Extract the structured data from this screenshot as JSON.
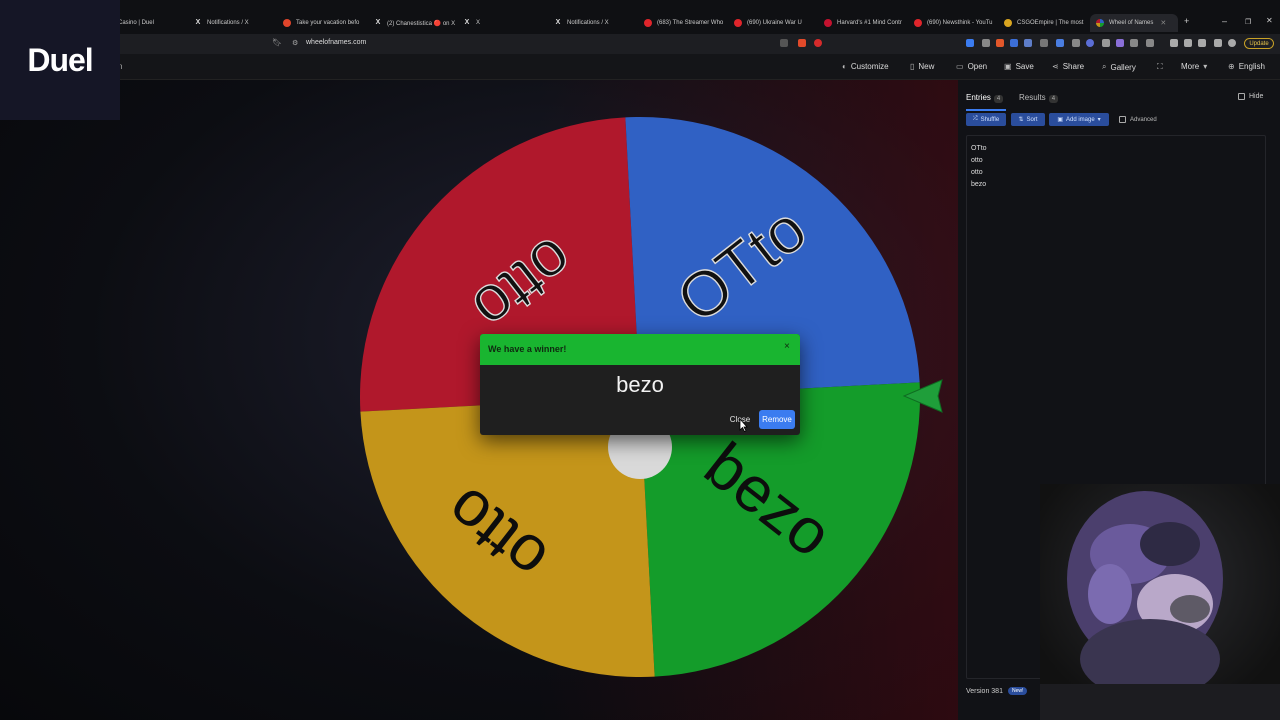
{
  "browser": {
    "tabs": [
      {
        "label": "Casino | Duel",
        "icon": "duel-favicon"
      },
      {
        "label": "Notifications / X",
        "icon": "x-icon"
      },
      {
        "label": "Take your vacation befo",
        "icon": "site-favicon"
      },
      {
        "label": "(2) Chanestisticа 🔴 on X",
        "icon": "x-icon"
      },
      {
        "label": "X",
        "icon": "x-icon"
      },
      {
        "label": "Notifications / X",
        "icon": "x-icon"
      },
      {
        "label": "(683) The Streamer Who",
        "icon": "youtube-icon"
      },
      {
        "label": "(690) Ukraine War U",
        "icon": "youtube-icon"
      },
      {
        "label": "Harvard's #1 Mind Contr",
        "icon": "site-favicon"
      },
      {
        "label": "(690) Newsthink - YouTu",
        "icon": "youtube-icon"
      },
      {
        "label": "CSGOEmpire | The most",
        "icon": "site-favicon"
      },
      {
        "label": "Wheel of Names",
        "icon": "wheel-favicon"
      }
    ],
    "new_tab": "+",
    "window_controls": [
      "–",
      "❐",
      "✕"
    ],
    "url": "wheelofnames.com",
    "update_label": "Update"
  },
  "brand_overlay": {
    "text": "Duel"
  },
  "app_menu": {
    "customize": "Customize",
    "new": "New",
    "open": "Open",
    "save": "Save",
    "share": "Share",
    "gallery": "Gallery",
    "more": "More",
    "language": "English",
    "left_fragment": "n"
  },
  "wheel": {
    "segments": [
      {
        "label": "OTto",
        "color": "#3061c4"
      },
      {
        "label": "bezo",
        "color": "#149c2a"
      },
      {
        "label": "otto",
        "color": "#c4951a"
      },
      {
        "label": "otto",
        "color": "#b0182c"
      }
    ],
    "pointer_color": "#1f9e3a"
  },
  "dialog": {
    "title": "We have a winner!",
    "close_icon": "×",
    "winner": "bezo",
    "close_label": "Close",
    "remove_label": "Remove",
    "header_color": "#19b530"
  },
  "panel": {
    "tab_entries": "Entries",
    "entries_count": "4",
    "tab_results": "Results",
    "results_count": "4",
    "hide_label": "Hide",
    "shuffle_label": "Shuffle",
    "sort_label": "Sort",
    "add_image_label": "Add image",
    "advanced_label": "Advanced",
    "entries": [
      "OTto",
      "otto",
      "otto",
      "bezo"
    ],
    "version": "Version 381",
    "new_badge": "New!"
  }
}
